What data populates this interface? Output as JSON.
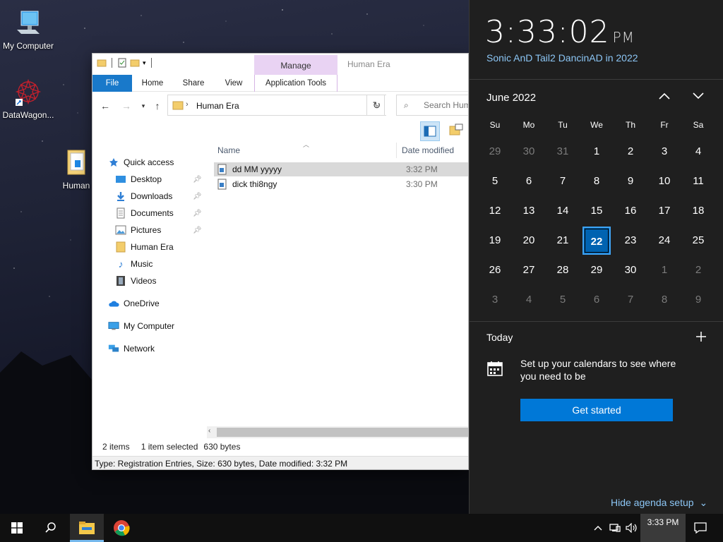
{
  "desktop": {
    "icons": [
      {
        "label": "My Computer"
      },
      {
        "label": "DataWagon..."
      },
      {
        "label": "Human"
      }
    ]
  },
  "explorer": {
    "window_title": "Human Era",
    "context_tab": "Manage",
    "ribbon_tabs": [
      "File",
      "Home",
      "Share",
      "View",
      "Application Tools"
    ],
    "address_path": "Human Era",
    "search_placeholder": "Search Human Era",
    "columns": {
      "name": "Name",
      "date": "Date modified"
    },
    "nav": {
      "quick_access": "Quick access",
      "items": [
        "Desktop",
        "Downloads",
        "Documents",
        "Pictures",
        "Human Era",
        "Music",
        "Videos"
      ],
      "onedrive": "OneDrive",
      "my_computer": "My Computer",
      "network": "Network"
    },
    "files": [
      {
        "name": "dd MM yyyyy",
        "date": "3:32 PM",
        "selected": true
      },
      {
        "name": "dick thi8ngy",
        "date": "3:30 PM",
        "selected": false
      }
    ],
    "status": {
      "items": "2 items",
      "selected": "1 item selected",
      "size": "630 bytes"
    },
    "info_bar": "Type: Registration Entries, Size: 630 bytes, Date modified:  3:32 PM"
  },
  "calendar": {
    "time": "3:33:02",
    "ampm": "PM",
    "date_line": "Sonic AnD Tail2 DancinAD in 2022",
    "month_label": "June 2022",
    "weekdays": [
      "Su",
      "Mo",
      "Tu",
      "We",
      "Th",
      "Fr",
      "Sa"
    ],
    "weeks": [
      [
        "29",
        "30",
        "31",
        "1",
        "2",
        "3",
        "4"
      ],
      [
        "5",
        "6",
        "7",
        "8",
        "9",
        "10",
        "11"
      ],
      [
        "12",
        "13",
        "14",
        "15",
        "16",
        "17",
        "18"
      ],
      [
        "19",
        "20",
        "21",
        "22",
        "23",
        "24",
        "25"
      ],
      [
        "26",
        "27",
        "28",
        "29",
        "30",
        "1",
        "2"
      ],
      [
        "3",
        "4",
        "5",
        "6",
        "7",
        "8",
        "9"
      ]
    ],
    "today_value": "22",
    "agenda": {
      "today_label": "Today",
      "setup_text": "Set up your calendars to see where you need to be",
      "button": "Get started",
      "hide_link": "Hide agenda setup"
    }
  },
  "taskbar": {
    "clock": "3:33 PM",
    "accent": "#0078d7"
  }
}
